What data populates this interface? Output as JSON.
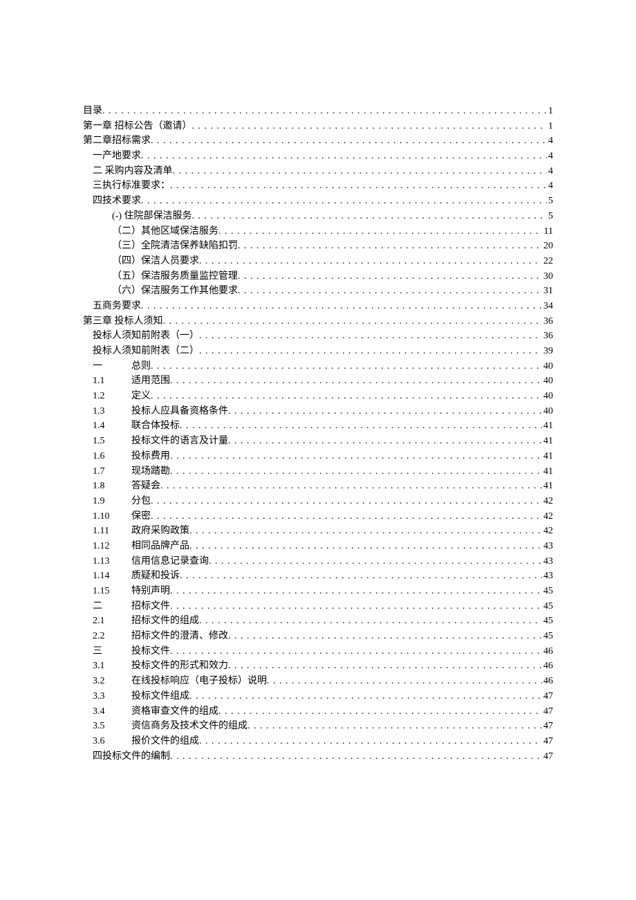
{
  "toc": [
    {
      "label": "目录",
      "page": "1",
      "indent": 0
    },
    {
      "label": "第一章 招标公告（邀请）",
      "page": "1",
      "indent": 0
    },
    {
      "label": "第二章招标需求",
      "page": "4",
      "indent": 0
    },
    {
      "label": "一产地要求",
      "page": "4",
      "indent": 1
    },
    {
      "label": "二 采购内容及清单",
      "page": "4",
      "indent": 1
    },
    {
      "label": "三执行标准要求：",
      "page": "4",
      "indent": 1
    },
    {
      "label": "四技术要求",
      "page": "5",
      "indent": 1
    },
    {
      "label": "(-) 住院部保洁服务",
      "page": "5",
      "indent": 2
    },
    {
      "label": "（二）其他区域保洁服务",
      "page": "11",
      "indent": 2
    },
    {
      "label": "（三）全院清洁保养缺陷扣罚",
      "page": "20",
      "indent": 2
    },
    {
      "label": "（四）保洁人员要求",
      "page": "22",
      "indent": 2
    },
    {
      "label": "（五）保洁服务质量监控管理",
      "page": "30",
      "indent": 2
    },
    {
      "label": "（六）保洁服务工作其他要求",
      "page": "31",
      "indent": 2
    },
    {
      "label": "五商务要求",
      "page": "34",
      "indent": 1
    },
    {
      "label": "第三章 投标人须知",
      "page": "36",
      "indent": 0
    },
    {
      "label": "投标人须知前附表（一）",
      "page": "36",
      "indent": 1
    },
    {
      "label": "投标人须知前附表（二）",
      "page": "39",
      "indent": 1
    },
    {
      "num": "一",
      "label": "总则",
      "page": "40",
      "indent": 3
    },
    {
      "num": "1.1",
      "label": "适用范围",
      "page": "40",
      "indent": 3
    },
    {
      "num": "1.2",
      "label": "定义",
      "page": "40",
      "indent": 3
    },
    {
      "num": "1.3",
      "label": "投标人应具备资格条件",
      "page": "40",
      "indent": 3
    },
    {
      "num": "1.4",
      "label": "联合体投标",
      "page": "41",
      "indent": 3
    },
    {
      "num": "1.5",
      "label": "投标文件的语言及计量",
      "page": "41",
      "indent": 3
    },
    {
      "num": "1.6",
      "label": "投标费用",
      "page": "41",
      "indent": 3
    },
    {
      "num": "1.7",
      "label": "现场踏勘",
      "page": "41",
      "indent": 3
    },
    {
      "num": "1.8",
      "label": "答疑会",
      "page": "41",
      "indent": 3
    },
    {
      "num": "1.9",
      "label": "分包",
      "page": "42",
      "indent": 3
    },
    {
      "num": "1.10",
      "label": "保密",
      "page": "42",
      "indent": 3
    },
    {
      "num": "1.11",
      "label": "政府采购政策",
      "page": "42",
      "indent": 3
    },
    {
      "num": "1.12",
      "label": "相同品牌产品",
      "page": "43",
      "indent": 3
    },
    {
      "num": "1.13",
      "label": "信用信息记录查询",
      "page": "43",
      "indent": 3
    },
    {
      "num": "1.14",
      "label": "质疑和投诉",
      "page": "43",
      "indent": 3
    },
    {
      "num": "1.15",
      "label": "特别声明",
      "page": "45",
      "indent": 3
    },
    {
      "num": "二",
      "label": "招标文件",
      "page": "45",
      "indent": 3
    },
    {
      "num": "2.1",
      "label": "招标文件的组成",
      "page": "45",
      "indent": 3
    },
    {
      "num": "2.2",
      "label": "招标文件的澄清、修改",
      "page": "45",
      "indent": 3
    },
    {
      "num": "三",
      "label": "投标文件",
      "page": "46",
      "indent": 3
    },
    {
      "num": "3.1",
      "label": "投标文件的形式和效力",
      "page": "46",
      "indent": 3
    },
    {
      "num": "3.2",
      "label": "在线投标响应（电子投标）说明",
      "page": "46",
      "indent": 3
    },
    {
      "num": "3.3",
      "label": "投标文件组成",
      "page": "47",
      "indent": 3
    },
    {
      "num": "3.4",
      "label": "资格审查文件的组成",
      "page": "47",
      "indent": 3
    },
    {
      "num": "3.5",
      "label": "资信商务及技术文件的组成",
      "page": "47",
      "indent": 3
    },
    {
      "num": "3.6",
      "label": "报价文件的组成",
      "page": "47",
      "indent": 3
    },
    {
      "label": "四投标文件的编制",
      "page": "47",
      "indent": 1
    }
  ]
}
